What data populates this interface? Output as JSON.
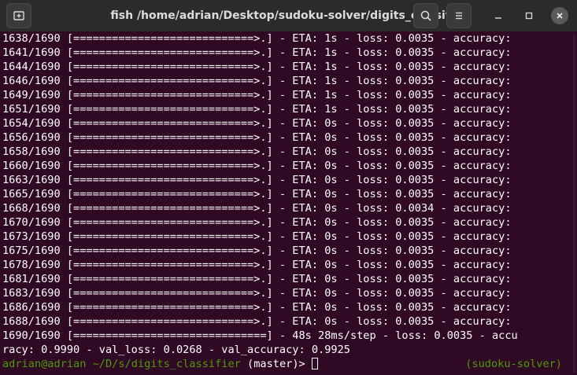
{
  "window": {
    "title": "fish /home/adrian/Desktop/sudoku-solver/digits_classifier"
  },
  "output_lines": [
    "1638/1690 [============================>.] - ETA: 1s - loss: 0.0035 - accuracy:",
    "1641/1690 [============================>.] - ETA: 1s - loss: 0.0035 - accuracy:",
    "1644/1690 [============================>.] - ETA: 1s - loss: 0.0035 - accuracy:",
    "1646/1690 [============================>.] - ETA: 1s - loss: 0.0035 - accuracy:",
    "1649/1690 [============================>.] - ETA: 1s - loss: 0.0035 - accuracy:",
    "1651/1690 [============================>.] - ETA: 1s - loss: 0.0035 - accuracy:",
    "1654/1690 [============================>.] - ETA: 0s - loss: 0.0035 - accuracy:",
    "1656/1690 [============================>.] - ETA: 0s - loss: 0.0035 - accuracy:",
    "1658/1690 [============================>.] - ETA: 0s - loss: 0.0035 - accuracy:",
    "1660/1690 [============================>.] - ETA: 0s - loss: 0.0035 - accuracy:",
    "1663/1690 [============================>.] - ETA: 0s - loss: 0.0035 - accuracy:",
    "1665/1690 [============================>.] - ETA: 0s - loss: 0.0035 - accuracy:",
    "1668/1690 [============================>.] - ETA: 0s - loss: 0.0034 - accuracy:",
    "1670/1690 [============================>.] - ETA: 0s - loss: 0.0035 - accuracy:",
    "1673/1690 [============================>.] - ETA: 0s - loss: 0.0035 - accuracy:",
    "1675/1690 [============================>.] - ETA: 0s - loss: 0.0035 - accuracy:",
    "1678/1690 [============================>.] - ETA: 0s - loss: 0.0035 - accuracy:",
    "1681/1690 [============================>.] - ETA: 0s - loss: 0.0035 - accuracy:",
    "1683/1690 [============================>.] - ETA: 0s - loss: 0.0035 - accuracy:",
    "1686/1690 [============================>.] - ETA: 0s - loss: 0.0035 - accuracy:",
    "1688/1690 [============================>.] - ETA: 0s - loss: 0.0035 - accuracy:",
    "1690/1690 [==============================] - 48s 28ms/step - loss: 0.0035 - accu",
    "racy: 0.9990 - val_loss: 0.0268 - val_accuracy: 0.9925"
  ],
  "prompt": {
    "user_host": "adrian@adrian",
    "cwd": "~/D/s/digits_classifier",
    "git_branch": "(master)>",
    "right_prompt": "(sudoku-solver)"
  },
  "colors": {
    "background": "#300a24",
    "titlebar": "#2b2b2b",
    "prompt_green": "#4e9a06",
    "text": "#ffffff"
  },
  "icons": {
    "new_tab": "new-tab-icon",
    "search": "search-icon",
    "menu": "hamburger-menu-icon",
    "minimize": "minimize-icon",
    "maximize": "maximize-icon",
    "close": "close-icon"
  }
}
